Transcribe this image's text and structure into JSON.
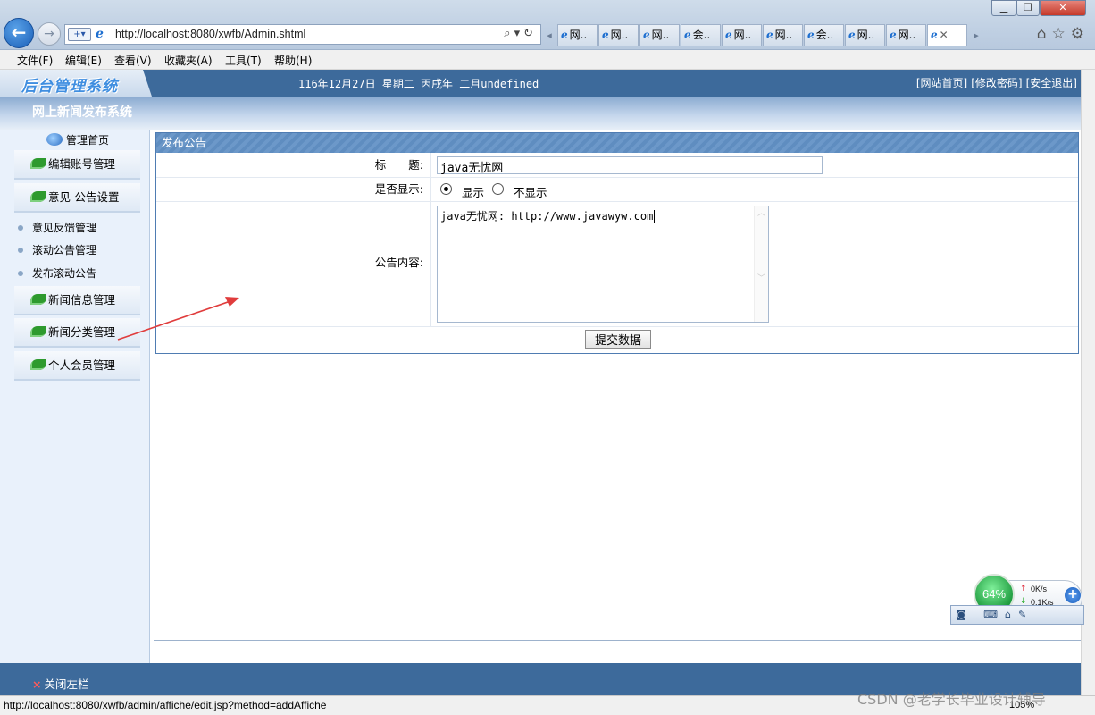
{
  "browser": {
    "url": "http://localhost:8080/xwfb/Admin.shtml",
    "tabs": [
      "网..",
      "网..",
      "网..",
      "会..",
      "网..",
      "网..",
      "会..",
      "网..",
      "网..",
      ""
    ],
    "menu": [
      "文件(F)",
      "编辑(E)",
      "查看(V)",
      "收藏夹(A)",
      "工具(T)",
      "帮助(H)"
    ],
    "status_url": "http://localhost:8080/xwfb/admin/affiche/edit.jsp?method=addAffiche",
    "zoom": "105%"
  },
  "header": {
    "logo": "后台管理系统",
    "date": "116年12月27日 星期二 丙戌年 二月undefined",
    "links": [
      "[网站首页]",
      "[修改密码]",
      "[安全退出]"
    ],
    "system_title": "网上新闻发布系统"
  },
  "sidebar": {
    "home": "管理首页",
    "buttons": [
      "编辑账号管理",
      "意见-公告设置",
      "新闻信息管理",
      "新闻分类管理",
      "个人会员管理"
    ],
    "subitems": [
      "意见反馈管理",
      "滚动公告管理",
      "发布滚动公告"
    ],
    "close_label": "关闭左栏"
  },
  "form": {
    "header": "发布公告",
    "title_label": "标　　题:",
    "title_value": "java无忧网",
    "display_label": "是否显示:",
    "display_options": [
      "显示",
      "不显示"
    ],
    "content_label": "公告内容:",
    "content_value": "java无忧网: http://www.javawyw.com",
    "submit_label": "提交数据"
  },
  "widget": {
    "percent": "64%",
    "up_speed": "0K/s",
    "down_speed": "0.1K/s"
  },
  "watermark": "CSDN @老学长毕业设计辅导",
  "colors": {
    "header_blue": "#3d6a9b",
    "accent_blue": "#5f8dc0",
    "arrow_red": "#e03c3c"
  }
}
